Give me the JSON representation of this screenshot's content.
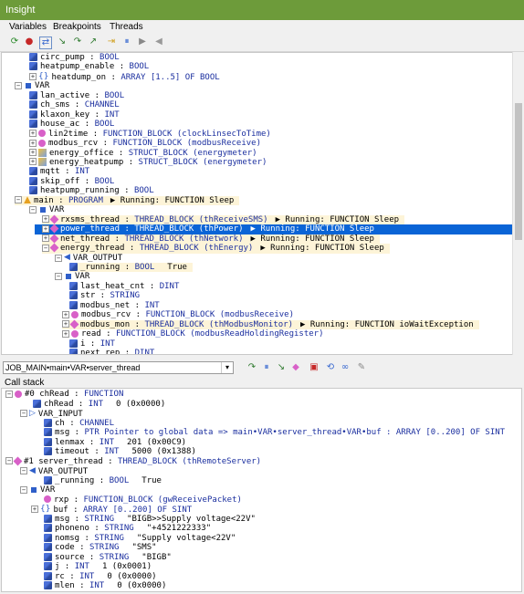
{
  "window": {
    "title": "Insight"
  },
  "menu": [
    {
      "label": "Variables"
    },
    {
      "label": "Breakpoints"
    },
    {
      "label": "Threads"
    }
  ],
  "toolbar_icons": [
    "refresh-icon",
    "stop-icon",
    "step-icon",
    "step-into-icon",
    "step-over-icon",
    "step-out-icon",
    "run-to-icon",
    "pause-icon",
    "continue-icon",
    "disabled-icon"
  ],
  "tree": {
    "rows": [
      {
        "indent": 30,
        "icon": "var",
        "text": "circ_pump : ",
        "type": "BOOL"
      },
      {
        "indent": 30,
        "icon": "var",
        "text": "heatpump_enable : ",
        "type": "BOOL"
      },
      {
        "indent": 30,
        "exp": "+",
        "icon": "arr",
        "glyph": "{}",
        "text": "heatdump_on : ",
        "type": "ARRAY [1..5] OF BOOL"
      },
      {
        "indent": 14,
        "exp": "-",
        "icon": "sq",
        "text": "VAR",
        "type": ""
      },
      {
        "indent": 30,
        "icon": "var",
        "text": "lan_active : ",
        "type": "BOOL"
      },
      {
        "indent": 30,
        "icon": "var",
        "text": "ch_sms : ",
        "type": "CHANNEL"
      },
      {
        "indent": 30,
        "icon": "var",
        "text": "klaxon_key : ",
        "type": "INT"
      },
      {
        "indent": 30,
        "icon": "var",
        "text": "house_ac : ",
        "type": "BOOL"
      },
      {
        "indent": 30,
        "exp": "+",
        "icon": "fb",
        "text": "lin2time : ",
        "type": "FUNCTION_BLOCK (clockLinsecToTime)"
      },
      {
        "indent": 30,
        "exp": "+",
        "icon": "fb",
        "text": "modbus_rcv : ",
        "type": "FUNCTION_BLOCK (modbusReceive)"
      },
      {
        "indent": 30,
        "exp": "+",
        "icon": "st",
        "text": "energy_office : ",
        "type": "STRUCT_BLOCK (energymeter)"
      },
      {
        "indent": 30,
        "exp": "+",
        "icon": "st",
        "text": "energy_heatpump : ",
        "type": "STRUCT_BLOCK (energymeter)"
      },
      {
        "indent": 30,
        "icon": "var",
        "text": "mqtt : ",
        "type": "INT"
      },
      {
        "indent": 30,
        "icon": "var",
        "text": "skip_off : ",
        "type": "BOOL"
      },
      {
        "indent": 30,
        "icon": "var",
        "text": "heatpump_running : ",
        "type": "BOOL"
      },
      {
        "indent": 14,
        "exp": "-",
        "icon": "pg",
        "text": "main : ",
        "type": "PROGRAM",
        "status": "▶ Running: FUNCTION Sleep"
      },
      {
        "indent": 30,
        "exp": "-",
        "icon": "sq",
        "text": "VAR",
        "type": ""
      },
      {
        "indent": 44,
        "exp": "+",
        "icon": "th",
        "text": "rxsms_thread : ",
        "type": "THREAD_BLOCK (thReceiveSMS)",
        "status": "▶ Running: FUNCTION Sleep"
      },
      {
        "indent": 44,
        "exp": "+",
        "icon": "th",
        "text": "power_thread : ",
        "type": "THREAD_BLOCK (thPower)",
        "status": "▶ Running: FUNCTION Sleep",
        "selected": true
      },
      {
        "indent": 44,
        "exp": "+",
        "icon": "th",
        "text": "net_thread : ",
        "type": "THREAD_BLOCK (thNetwork)",
        "status": "▶ Running: FUNCTION Sleep"
      },
      {
        "indent": 44,
        "exp": "-",
        "icon": "th",
        "text": "energy_thread : ",
        "type": "THREAD_BLOCK (thEnergy)",
        "status": "▶ Running: FUNCTION Sleep"
      },
      {
        "indent": 58,
        "exp": "-",
        "icon": "arr",
        "glyph": "◀",
        "text": "VAR_OUTPUT",
        "type": ""
      },
      {
        "indent": 74,
        "icon": "var",
        "text": "_running : ",
        "type": "BOOL",
        "value": "True",
        "runbg": true
      },
      {
        "indent": 58,
        "exp": "-",
        "icon": "sq",
        "text": "VAR",
        "type": ""
      },
      {
        "indent": 74,
        "icon": "var",
        "text": "last_heat_cnt : ",
        "type": "DINT"
      },
      {
        "indent": 74,
        "icon": "var",
        "text": "str : ",
        "type": "STRING"
      },
      {
        "indent": 74,
        "icon": "var",
        "text": "modbus_net : ",
        "type": "INT"
      },
      {
        "indent": 66,
        "exp": "+",
        "icon": "fb",
        "text": "modbus_rcv : ",
        "type": "FUNCTION_BLOCK (modbusReceive)"
      },
      {
        "indent": 66,
        "exp": "+",
        "icon": "th",
        "text": "modbus_mon : ",
        "type": "THREAD_BLOCK (thModbusMonitor)",
        "status": "▶ Running: FUNCTION ioWaitException"
      },
      {
        "indent": 66,
        "exp": "+",
        "icon": "fb",
        "text": "read : ",
        "type": "FUNCTION_BLOCK (modbusReadHoldingRegister)"
      },
      {
        "indent": 74,
        "icon": "var",
        "text": "i : ",
        "type": "INT"
      },
      {
        "indent": 74,
        "icon": "var",
        "text": "next_rep : ",
        "type": "DINT"
      }
    ]
  },
  "combo": {
    "value": "JOB_MAIN•main•VAR•server_thread"
  },
  "midbar_icons": [
    "step-icon",
    "pause-icon",
    "step-into-icon",
    "run-icon",
    "watch-icon",
    "reset-icon",
    "link-icon",
    "clear-icon"
  ],
  "callstack": {
    "label": "Call stack",
    "rows": [
      {
        "indent": 4,
        "exp": "-",
        "icon": "fb",
        "text": "#0 chRead : ",
        "type": "FUNCTION"
      },
      {
        "indent": 34,
        "icon": "var",
        "text": "chRead : ",
        "type": "INT",
        "value": "0 (0x0000)"
      },
      {
        "indent": 20,
        "exp": "-",
        "icon": "arr",
        "glyph": "▷",
        "text": "VAR_INPUT",
        "type": ""
      },
      {
        "indent": 46,
        "icon": "var",
        "text": "ch : ",
        "type": "CHANNEL"
      },
      {
        "indent": 46,
        "icon": "var",
        "text": "msg : ",
        "type": "PTR Pointer to global data => main•VAR•server_thread•VAR•buf : ARRAY [0..200] OF SINT"
      },
      {
        "indent": 46,
        "icon": "var",
        "text": "lenmax : ",
        "type": "INT",
        "value": "201 (0x00C9)"
      },
      {
        "indent": 46,
        "icon": "var",
        "text": "timeout : ",
        "type": "INT",
        "value": "5000 (0x1388)"
      },
      {
        "indent": 4,
        "exp": "-",
        "icon": "th",
        "text": "#1 server_thread : ",
        "type": "THREAD_BLOCK (thRemoteServer)"
      },
      {
        "indent": 20,
        "exp": "-",
        "icon": "arr",
        "glyph": "◀",
        "text": "VAR_OUTPUT",
        "type": ""
      },
      {
        "indent": 46,
        "icon": "var",
        "text": "_running : ",
        "type": "BOOL",
        "value": "True"
      },
      {
        "indent": 20,
        "exp": "-",
        "icon": "sq",
        "text": "VAR",
        "type": ""
      },
      {
        "indent": 46,
        "icon": "fb",
        "text": "rxp : ",
        "type": "FUNCTION_BLOCK (gwReceivePacket)"
      },
      {
        "indent": 32,
        "exp": "+",
        "icon": "arr",
        "glyph": "{}",
        "text": "buf : ",
        "type": "ARRAY [0..200] OF SINT"
      },
      {
        "indent": 46,
        "icon": "var",
        "text": "msg : ",
        "type": "STRING",
        "value": "\"BIGB>>Supply voltage<22V\""
      },
      {
        "indent": 46,
        "icon": "var",
        "text": "phoneno : ",
        "type": "STRING",
        "value": "\"+4521222333\""
      },
      {
        "indent": 46,
        "icon": "var",
        "text": "nomsg : ",
        "type": "STRING",
        "value": "\"Supply voltage<22V\""
      },
      {
        "indent": 46,
        "icon": "var",
        "text": "code : ",
        "type": "STRING",
        "value": "\"SMS\""
      },
      {
        "indent": 46,
        "icon": "var",
        "text": "source : ",
        "type": "STRING",
        "value": "\"BIGB\""
      },
      {
        "indent": 46,
        "icon": "var",
        "text": "j : ",
        "type": "INT",
        "value": "1 (0x0001)"
      },
      {
        "indent": 46,
        "icon": "var",
        "text": "rc : ",
        "type": "INT",
        "value": "0 (0x0000)"
      },
      {
        "indent": 46,
        "icon": "var",
        "text": "mlen : ",
        "type": "INT",
        "value": "0 (0x0000)"
      }
    ]
  }
}
